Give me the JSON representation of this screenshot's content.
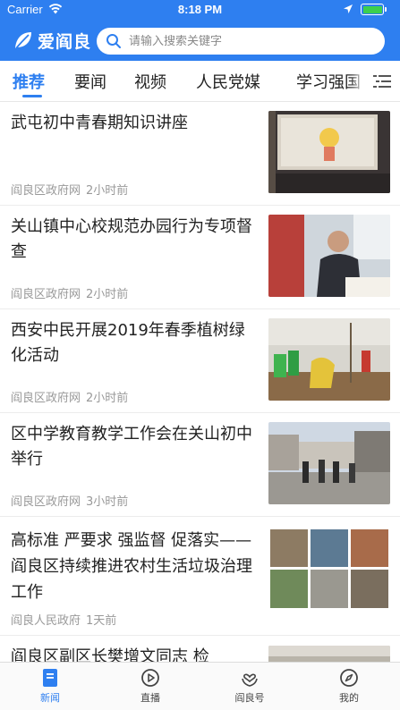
{
  "status_bar": {
    "carrier": "Carrier",
    "time": "8:18 PM"
  },
  "app": {
    "name": "爱阎良",
    "search_placeholder": "请输入搜索关键字"
  },
  "tabs": [
    "推荐",
    "要闻",
    "视频",
    "人民党媒",
    "学习强国"
  ],
  "active_tab": "推荐",
  "articles": [
    {
      "title": "武屯初中青春期知识讲座",
      "source": "阎良区政府网",
      "time": "2小时前",
      "thumb": "classroom-projection-photo"
    },
    {
      "title": "关山镇中心校规范办园行为专项督查",
      "source": "阎良区政府网",
      "time": "2小时前",
      "thumb": "office-inspection-photo"
    },
    {
      "title": "西安中民开展2019年春季植树绿化活动",
      "source": "阎良区政府网",
      "time": "2小时前",
      "thumb": "tree-planting-photo"
    },
    {
      "title": "区中学教育教学工作会在关山初中举行",
      "source": "阎良区政府网",
      "time": "3小时前",
      "thumb": "school-visit-photo"
    },
    {
      "title": "高标准 严要求 强监督 促落实——阎良区持续推进农村生活垃圾治理工作",
      "source": "阎良人民政府",
      "time": "1天前",
      "thumb": "rural-cleanup-collage"
    },
    {
      "title": "阎良区副区长樊增文同志 检",
      "source": "",
      "time": "",
      "thumb": "meeting-photo"
    }
  ],
  "tab_bar": [
    {
      "label": "新闻",
      "icon": "news-icon",
      "active": true
    },
    {
      "label": "直播",
      "icon": "play-icon",
      "active": false
    },
    {
      "label": "阎良号",
      "icon": "heart-hands-icon",
      "active": false
    },
    {
      "label": "我的",
      "icon": "compass-icon",
      "active": false
    }
  ],
  "colors": {
    "brand": "#2e7ff0",
    "battery": "#3ccf4e"
  }
}
